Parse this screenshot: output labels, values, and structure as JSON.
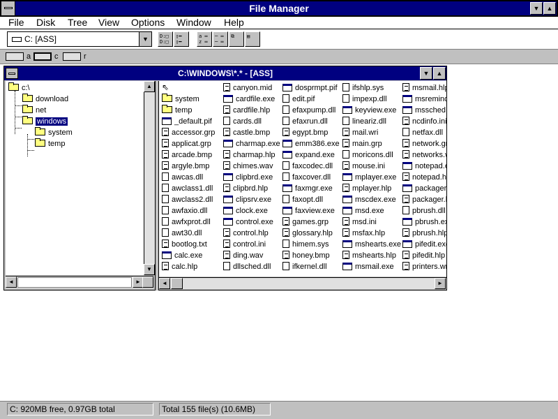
{
  "app_title": "File Manager",
  "menu": [
    "File",
    "Disk",
    "Tree",
    "View",
    "Options",
    "Window",
    "Help"
  ],
  "toolbar": {
    "drive_value": "C: [ASS]"
  },
  "drives": [
    {
      "label": "a"
    },
    {
      "label": "c"
    },
    {
      "label": "r"
    }
  ],
  "window_title": "C:\\WINDOWS\\*.* - [ASS]",
  "tree": {
    "root": "c:\\",
    "children": [
      "download",
      "net",
      "windows"
    ],
    "selected": "windows",
    "sub": [
      "system",
      "temp"
    ]
  },
  "files": {
    "col1": [
      "system",
      "temp",
      "_default.pif",
      "accessor.grp",
      "applicat.grp",
      "arcade.bmp",
      "argyle.bmp",
      "awcas.dll",
      "awclass1.dll",
      "awclass2.dll",
      "awfaxio.dll",
      "awfxprot.dll",
      "awt30.dll",
      "bootlog.txt",
      "calc.exe",
      "calc.hlp"
    ],
    "col2": [
      "canyon.mid",
      "cardfile.exe",
      "cardfile.hlp",
      "cards.dll",
      "castle.bmp",
      "charmap.exe",
      "charmap.hlp",
      "chimes.wav",
      "clipbrd.exe",
      "clipbrd.hlp",
      "clipsrv.exe",
      "clock.exe",
      "control.exe",
      "control.hlp",
      "control.ini",
      "ding.wav",
      "dllsched.dll"
    ],
    "col3": [
      "dosprmpt.pif",
      "edit.pif",
      "efaxpump.dll",
      "efaxrun.dll",
      "egypt.bmp",
      "emm386.exe",
      "expand.exe",
      "faxcodec.dll",
      "faxcover.dll",
      "faxmgr.exe",
      "faxopt.dll",
      "faxview.exe",
      "games.grp",
      "glossary.hlp",
      "himem.sys",
      "honey.bmp",
      "ifkernel.dll"
    ],
    "col4": [
      "ifshlp.sys",
      "impexp.dll",
      "keyview.exe",
      "lineariz.dll",
      "mail.wri",
      "main.grp",
      "moricons.dll",
      "mouse.ini",
      "mplayer.exe",
      "mplayer.hlp",
      "mscdex.exe",
      "msd.exe",
      "msd.ini",
      "msfax.hlp",
      "mshearts.exe",
      "mshearts.hlp",
      "msmail.exe"
    ],
    "col5": [
      "msmail.hlp",
      "msremind.exe",
      "mssched.exe",
      "ncdinfo.ini",
      "netfax.dll",
      "network.grp",
      "networks.wri",
      "notepad.exe",
      "notepad.hlp",
      "packager.exe",
      "packager.hlp",
      "pbrush.dll",
      "pbrush.exe",
      "pbrush.hlp",
      "pifedit.exe",
      "pifedit.hlp",
      "printers.wri"
    ]
  },
  "status": {
    "disk": "C: 920MB free,  0.97GB total",
    "files": "Total 155 file(s) (10.6MB)"
  }
}
